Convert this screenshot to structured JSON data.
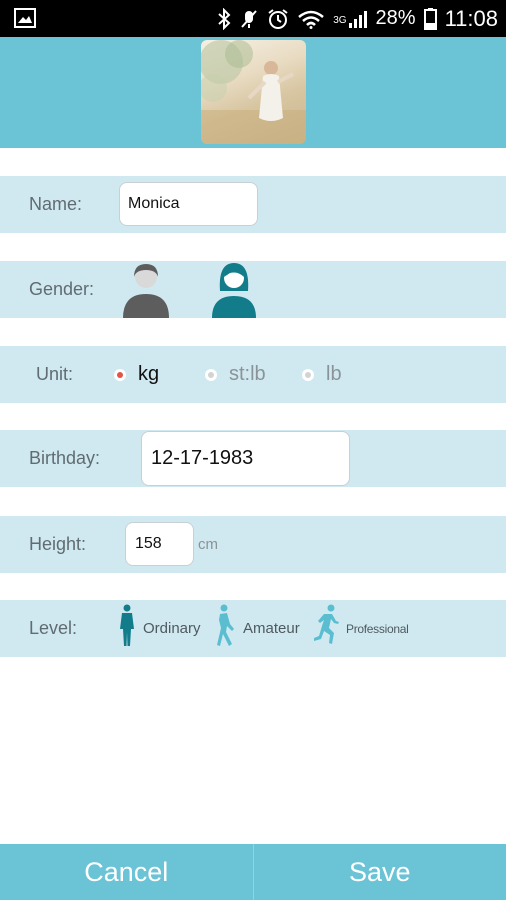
{
  "status_bar": {
    "network": "3G",
    "battery": "28%",
    "time": "11:08",
    "icons": [
      "image-icon",
      "bluetooth-icon",
      "mute-icon",
      "alarm-icon",
      "wifi-icon",
      "signal-icon",
      "battery-icon"
    ]
  },
  "form": {
    "name": {
      "label": "Name:",
      "value": "Monica"
    },
    "gender": {
      "label": "Gender:",
      "options": [
        "male",
        "female"
      ],
      "selected": "female"
    },
    "unit": {
      "label": "Unit:",
      "options": [
        {
          "label": "kg",
          "checked": true
        },
        {
          "label": "st:lb",
          "checked": false
        },
        {
          "label": "lb",
          "checked": false
        }
      ]
    },
    "birthday": {
      "label": "Birthday:",
      "value": "12-17-1983"
    },
    "height": {
      "label": "Height:",
      "value": "158",
      "unit": "cm"
    },
    "level": {
      "label": "Level:",
      "options": [
        {
          "label": "Ordinary"
        },
        {
          "label": "Amateur"
        },
        {
          "label": "Professional"
        }
      ]
    }
  },
  "actions": {
    "cancel": "Cancel",
    "save": "Save"
  },
  "colors": {
    "header": "#6bc3d6",
    "row": "#d0e9f1",
    "teal_dark": "#127c8b",
    "teal_light": "#5bbdd0",
    "radio_checked": "#e05548"
  }
}
